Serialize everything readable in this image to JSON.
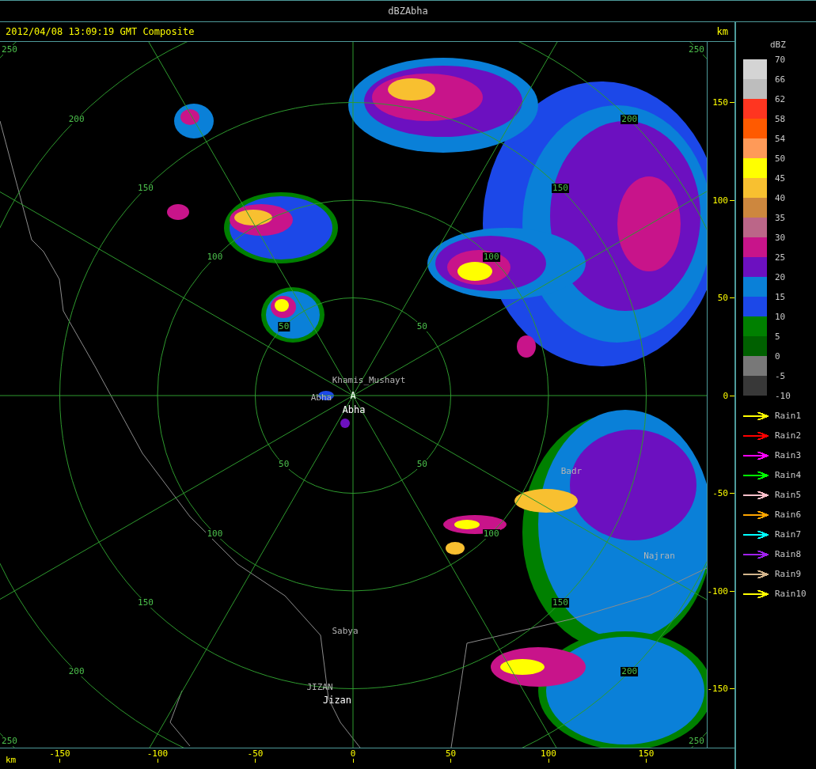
{
  "window": {
    "title": "dBZAbha"
  },
  "header": {
    "timestamp": "2012/04/08 13:09:19 GMT Composite",
    "axis_unit": "km"
  },
  "range_rings": [
    {
      "labels": [
        "50",
        "50",
        "50",
        "50"
      ]
    },
    {
      "labels": [
        "100",
        "100",
        "100",
        "100"
      ]
    },
    {
      "labels": [
        "150",
        "150",
        "150",
        "150"
      ]
    },
    {
      "labels": [
        "200",
        "200",
        "200",
        "200"
      ]
    },
    {
      "labels": [
        "250",
        "250",
        "250",
        "250"
      ]
    }
  ],
  "places": [
    {
      "name": "Khamis_Mushayt",
      "kind": "minor"
    },
    {
      "name": "Abha",
      "kind": "minor"
    },
    {
      "name": "A",
      "kind": "site"
    },
    {
      "name": "Abha",
      "kind": "major"
    },
    {
      "name": "Badr",
      "kind": "minor"
    },
    {
      "name": "Najran",
      "kind": "minor"
    },
    {
      "name": "Sabya",
      "kind": "minor"
    },
    {
      "name": "JIZAN",
      "kind": "minor"
    },
    {
      "name": "Jizan",
      "kind": "major"
    }
  ],
  "y_axis": {
    "ticks": [
      "150",
      "100",
      "50",
      "0",
      "-50",
      "-100",
      "-150"
    ]
  },
  "x_axis": {
    "unit": "km",
    "ticks": [
      "-150",
      "-100",
      "-50",
      "0",
      "50",
      "100",
      "150"
    ]
  },
  "legend": {
    "title": "dBZ",
    "labels": [
      "70",
      "66",
      "62",
      "58",
      "54",
      "50",
      "45",
      "40",
      "35",
      "30",
      "25",
      "20",
      "15",
      "10",
      "5",
      "0",
      "-5",
      "-10"
    ],
    "bands": [
      {
        "color": "#d4d4d4"
      },
      {
        "color": "#bdbdbd"
      },
      {
        "color": "#ff3520"
      },
      {
        "color": "#ff5a00"
      },
      {
        "color": "#ff9a58"
      },
      {
        "color": "#ffff00"
      },
      {
        "color": "#f8c030"
      },
      {
        "color": "#cd873e"
      },
      {
        "color": "#bb6688"
      },
      {
        "color": "#c8148a"
      },
      {
        "color": "#6c10c0"
      },
      {
        "color": "#0a80d8"
      },
      {
        "color": "#1c48e8"
      },
      {
        "color": "#008000"
      },
      {
        "color": "#006000"
      },
      {
        "color": "#787878"
      },
      {
        "color": "#383838"
      }
    ]
  },
  "tracks": [
    {
      "label": "Rain1",
      "color": "#ffff00"
    },
    {
      "label": "Rain2",
      "color": "#ff0000"
    },
    {
      "label": "Rain3",
      "color": "#ff00ff"
    },
    {
      "label": "Rain4",
      "color": "#00ff00"
    },
    {
      "label": "Rain5",
      "color": "#ffc0cb"
    },
    {
      "label": "Rain6",
      "color": "#ffa500"
    },
    {
      "label": "Rain7",
      "color": "#00ffff"
    },
    {
      "label": "Rain8",
      "color": "#a020f0"
    },
    {
      "label": "Rain9",
      "color": "#d2b48c"
    },
    {
      "label": "Rain10",
      "color": "#ffff00"
    }
  ]
}
